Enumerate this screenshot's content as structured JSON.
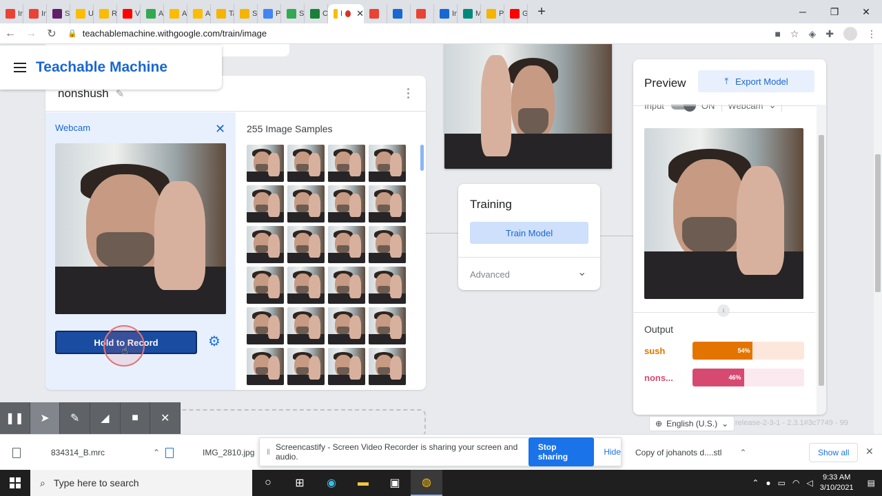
{
  "browser": {
    "tabs": [
      {
        "label": "Inb",
        "color": "#ea4335"
      },
      {
        "label": "Inb",
        "color": "#ea4335"
      },
      {
        "label": "Sla",
        "color": "#611f69"
      },
      {
        "label": "Up",
        "color": "#fbbc04"
      },
      {
        "label": "Rai",
        "color": "#fbbc04"
      },
      {
        "label": "Vid",
        "color": "#ff0000"
      },
      {
        "label": "Aar",
        "color": "#34a853"
      },
      {
        "label": "Aar",
        "color": "#fbbc04"
      },
      {
        "label": "Aar",
        "color": "#fbbc04"
      },
      {
        "label": "Talo",
        "color": "#f4b400"
      },
      {
        "label": "Scr",
        "color": "#f4b400"
      },
      {
        "label": "Pla",
        "color": "#4285f4"
      },
      {
        "label": "Sec",
        "color": "#34a853"
      },
      {
        "label": "Cla",
        "color": "#188038"
      }
    ],
    "active_tab": {
      "label": "I",
      "close": "✕"
    },
    "tabs_after": [
      {
        "label": "",
        "color": "#ea4335"
      },
      {
        "label": "",
        "color": "#1967d2"
      },
      {
        "label": "",
        "color": "#ea4335"
      },
      {
        "label": "Ima",
        "color": "#1967d2"
      },
      {
        "label": "Me",
        "color": "#00897b"
      },
      {
        "label": "Pin",
        "color": "#f4b400"
      },
      {
        "label": "Ge",
        "color": "#ff0000"
      }
    ],
    "new_tab": "+",
    "url": "teachablemachine.withgoogle.com/train/image"
  },
  "app": {
    "title": "Teachable Machine",
    "class_name": "nonshush",
    "webcam_label": "Webcam",
    "samples_label": "255 Image Samples",
    "sample_count": 24,
    "record_label": "Hold to Record",
    "training": {
      "title": "Training",
      "train_button": "Train Model",
      "advanced": "Advanced"
    },
    "preview": {
      "title": "Preview",
      "export_button": "Export Model",
      "input_label": "Input",
      "input_toggle": "ON",
      "input_source": "Webcam",
      "output_title": "Output",
      "outputs": [
        {
          "label": "sush",
          "percent": 54,
          "percent_label": "54%",
          "color": "#e37400",
          "track": "#fde7dc"
        },
        {
          "label": "nons...",
          "percent": 46,
          "percent_label": "46%",
          "color": "#d64a72",
          "track": "#fce8ef"
        }
      ]
    },
    "language": "English (U.S.)",
    "release": "release-2-3-1 - 2.3.1#3c7749 - 99"
  },
  "screencastify": {
    "banner": "Screencastify - Screen Video Recorder is sharing your screen and audio.",
    "stop": "Stop sharing",
    "hide": "Hide"
  },
  "downloads": {
    "items": [
      "834314_B.mrc",
      "IMG_2810.jpg",
      "Copy of johanots d....stl"
    ],
    "show_all": "Show all"
  },
  "taskbar": {
    "search_placeholder": "Type here to search",
    "time": "9:33 AM",
    "date": "3/10/2021"
  }
}
